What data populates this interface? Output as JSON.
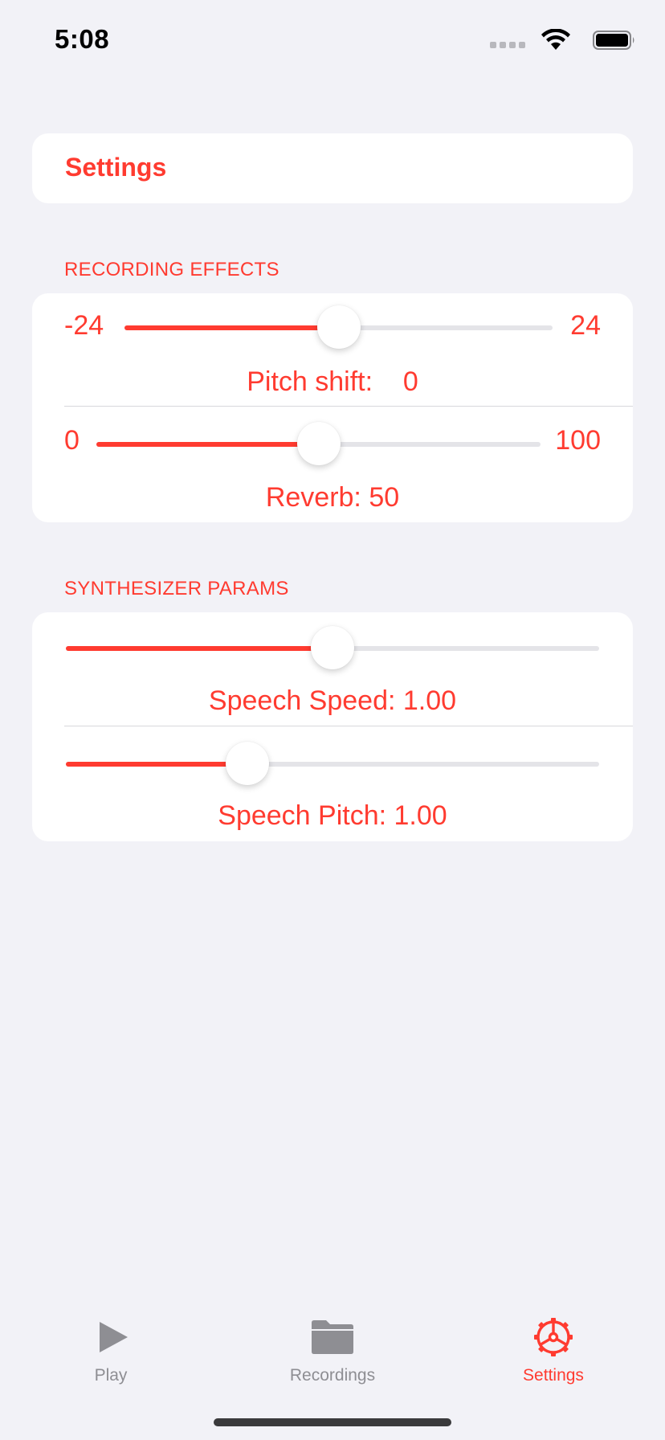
{
  "status_bar": {
    "time": "5:08"
  },
  "header": {
    "title": "Settings"
  },
  "recording_effects": {
    "section_title": "RECORDING EFFECTS",
    "pitch": {
      "min_label": "-24",
      "max_label": "24",
      "caption": "Pitch shift:    0",
      "min": -24,
      "max": 24,
      "value": 0
    },
    "reverb": {
      "min_label": "0",
      "max_label": "100",
      "caption": "Reverb: 50",
      "min": 0,
      "max": 100,
      "value": 50
    }
  },
  "synthesizer_params": {
    "section_title": "SYNTHESIZER PARAMS",
    "speech_speed": {
      "caption": "Speech Speed: 1.00",
      "fill_fraction": 0.5
    },
    "speech_pitch": {
      "caption": "Speech Pitch: 1.00",
      "fill_fraction": 0.34
    }
  },
  "tab_bar": {
    "tabs": [
      {
        "label": "Play",
        "icon": "play-icon",
        "active": false
      },
      {
        "label": "Recordings",
        "icon": "folder-icon",
        "active": false
      },
      {
        "label": "Settings",
        "icon": "gear-icon",
        "active": true
      }
    ]
  },
  "colors": {
    "accent": "#ff3b30",
    "background": "#f2f2f7",
    "inactive_tab": "#8e8e93",
    "track": "#e4e4e8"
  }
}
